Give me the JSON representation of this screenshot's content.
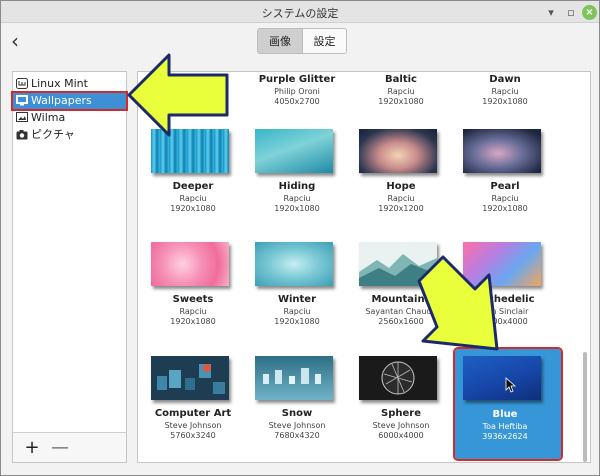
{
  "window": {
    "title": "システムの設定"
  },
  "tabs": [
    {
      "label": "画像",
      "active": true
    },
    {
      "label": "設定",
      "active": false
    }
  ],
  "sidebar": {
    "items": [
      {
        "label": "Linux Mint",
        "icon": "mint-logo-icon"
      },
      {
        "label": "Wallpapers",
        "icon": "monitor-icon",
        "selected": true
      },
      {
        "label": "Wilma",
        "icon": "image-icon"
      },
      {
        "label": "ピクチャ",
        "icon": "camera-icon"
      }
    ],
    "add_label": "+",
    "remove_label": "—"
  },
  "wallpapers": [
    {
      "name": "Purple Glitter",
      "author": "Philip Oroni",
      "res": "4050x2700"
    },
    {
      "name": "Baltic",
      "author": "Rapciu",
      "res": "1920x1080"
    },
    {
      "name": "Dawn",
      "author": "Rapciu",
      "res": "1920x1080"
    },
    {
      "name": "Deeper",
      "author": "Rapciu",
      "res": "1920x1080"
    },
    {
      "name": "Hiding",
      "author": "Rapciu",
      "res": "1920x1080"
    },
    {
      "name": "Hope",
      "author": "Rapciu",
      "res": "1920x1200"
    },
    {
      "name": "Pearl",
      "author": "Rapciu",
      "res": "1920x1080"
    },
    {
      "name": "Sweets",
      "author": "Rapciu",
      "res": "1920x1080"
    },
    {
      "name": "Winter",
      "author": "Rapciu",
      "res": "1920x1080"
    },
    {
      "name": "Mountains",
      "author": "Sayantan Chaudh",
      "res": "2560x1600"
    },
    {
      "name": "sychedelic",
      "author": "ean Sinclair",
      "res": "6000x4000"
    },
    {
      "name": "Computer Art",
      "author": "Steve Johnson",
      "res": "5760x3240"
    },
    {
      "name": "Snow",
      "author": "Steve Johnson",
      "res": "7680x4320"
    },
    {
      "name": "Sphere",
      "author": "Steve Johnson",
      "res": "6000x4000"
    },
    {
      "name": "Blue",
      "author": "Toa Heftiba",
      "res": "3936x2624",
      "selected": true
    }
  ]
}
